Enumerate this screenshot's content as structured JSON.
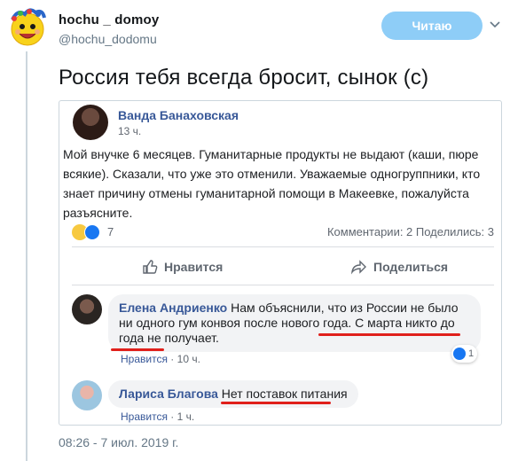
{
  "user": {
    "display_name": "hochu _ domoy",
    "handle": "@hochu_dodomu",
    "follow_label": "Читаю"
  },
  "tweet": {
    "text": "Россия тебя всегда бросит, сынок (с)",
    "date": "08:26 - 7 июл. 2019 г."
  },
  "fb_post": {
    "author": "Ванда Банаховская",
    "time": "13 ч.",
    "text": "Мой внучке 6 месяцев. Гуманитарные продукты не выдают (каши, пюре всякие). Сказали, что уже это отменили. Уважаемые одногруппники, кто знает причину отмены гуманитарной помощи в Макеевке, пожалуйста разъясните.",
    "reactions_count": "7",
    "stats": "Комментарии: 2  Поделились: 3",
    "like_label": "Нравится",
    "share_label": "Поделиться"
  },
  "comments": [
    {
      "author": "Елена Андриенко",
      "text_part1": "Нам объяснили, что из России не было ни одного гум конвоя после нового года. ",
      "text_part2": "С марта никто до года не получает.",
      "like_label": "Нравится",
      "time": "10 ч.",
      "reactions": "1"
    },
    {
      "author": "Лариса Благова",
      "text": "Нет поставок питания",
      "like_label": "Нравится",
      "time": "1 ч."
    }
  ],
  "colors": {
    "follow_button": "#8ecdf7",
    "fb_link": "#385898",
    "highlight_underline": "#e0201b"
  }
}
